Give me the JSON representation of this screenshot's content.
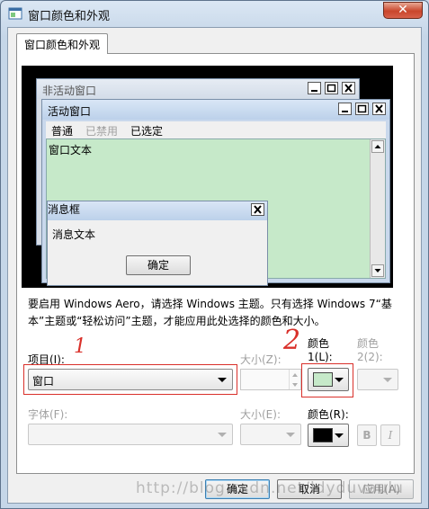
{
  "window": {
    "title": "窗口颜色和外观",
    "close_glyph": "✕"
  },
  "tab": {
    "label": "窗口颜色和外观"
  },
  "preview": {
    "inactive_title": "非活动窗口",
    "active_title": "活动窗口",
    "menu": {
      "normal": "普通",
      "disabled": "已禁用",
      "selected": "已选定"
    },
    "window_text": "窗口文本",
    "msgbox_title": "消息框",
    "msgbox_text": "消息文本",
    "msgbox_ok": "确定"
  },
  "description": "要启用 Windows Aero，请选择 Windows 主题。只有选择 Windows 7“基本”主题或“轻松访问”主题，才能应用此处选择的颜色和大小。",
  "item": {
    "label": "项目(I):",
    "value": "窗口"
  },
  "size1": {
    "label": "大小(Z):",
    "value": ""
  },
  "color1": {
    "label_line1": "颜色",
    "label_line2": "1(L):",
    "swatch": "#c6e9c9"
  },
  "color2": {
    "label_line1": "颜色",
    "label_line2": "2(2):"
  },
  "font": {
    "label": "字体(F):",
    "value": ""
  },
  "size2": {
    "label": "大小(E):",
    "value": ""
  },
  "font_color": {
    "label": "颜色(R):",
    "swatch": "#000000"
  },
  "bold": {
    "label": "B"
  },
  "italic": {
    "label": "I"
  },
  "annotations": {
    "one": "1",
    "two": "2"
  },
  "buttons": {
    "ok": "确定",
    "cancel": "取消",
    "apply": "应用(A)"
  },
  "watermark": "http://blog.csdn.net/ldyduvaulu",
  "colors": {
    "accent_red": "#d9302a",
    "window_text_bg": "#c6e9c9"
  }
}
